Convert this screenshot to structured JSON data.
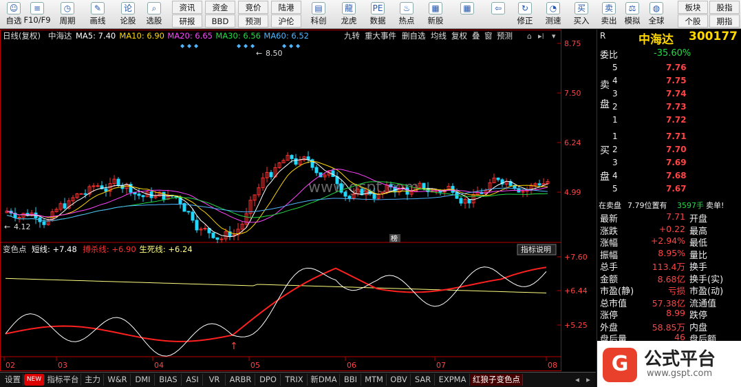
{
  "toolbar": {
    "buttons": [
      {
        "label": "自选",
        "icon": "user-icon"
      },
      {
        "label": "F10/F9",
        "icon": "document-icon"
      },
      {
        "label": "周期",
        "icon": "clock-icon"
      },
      {
        "label": "画线",
        "icon": "pen-icon"
      },
      {
        "label": "论股",
        "icon": "chat-icon"
      },
      {
        "label": "选股",
        "icon": "filter-icon"
      }
    ],
    "small_buttons": [
      "资讯",
      "资金",
      "竞价",
      "陆港",
      "研报",
      "BBD",
      "预测",
      "沪伦"
    ],
    "right_buttons": [
      {
        "label": "科创",
        "icon": "chart-icon"
      },
      {
        "label": "龙虎",
        "icon": "dragon-icon"
      },
      {
        "label": "数据",
        "icon": "pe-icon"
      },
      {
        "label": "热点",
        "icon": "hot-icon"
      },
      {
        "label": "新股",
        "icon": "ipo-icon"
      },
      {
        "label": "",
        "icon": "grid-icon"
      },
      {
        "label": "",
        "icon": "back-icon"
      },
      {
        "label": "修正",
        "icon": "refresh-icon"
      },
      {
        "label": "测速",
        "icon": "speed-icon"
      },
      {
        "label": "买入",
        "icon": "buy-icon"
      },
      {
        "label": "卖出",
        "icon": "sell-icon"
      },
      {
        "label": "模拟",
        "icon": "gavel-icon"
      },
      {
        "label": "全球",
        "icon": "globe-icon"
      }
    ],
    "far_right": [
      "板块",
      "股指",
      "个股",
      "期指"
    ]
  },
  "kchart": {
    "period": "日线(复权)",
    "name": "中海达",
    "ma": [
      {
        "label": "MA5: 7.40",
        "color": "#ffffff"
      },
      {
        "label": "MA10: 6.90",
        "color": "#ffd800"
      },
      {
        "label": "MA20: 6.65",
        "color": "#ff44ff"
      },
      {
        "label": "MA30: 6.56",
        "color": "#22dd44"
      },
      {
        "label": "MA60: 6.52",
        "color": "#4fb5ff"
      }
    ],
    "menu": [
      "九转",
      "重大事件",
      "删自选",
      "均线",
      "复权",
      "叠",
      "窗",
      "预测"
    ],
    "y_ticks": [
      "8.75",
      "7.50",
      "6.24",
      "4.99"
    ],
    "high_label": "8.50",
    "low_label": "4.12",
    "watermark": "www.gspt.com",
    "overlay_tag": "榜"
  },
  "indicator": {
    "title": "变色点",
    "lines": [
      {
        "label": "短线: +7.48",
        "color": "#ffffff"
      },
      {
        "label": "搏杀线: +6.90",
        "color": "#ff3030"
      },
      {
        "label": "生死线: +6.24",
        "color": "#ffff80"
      }
    ],
    "help_button": "指标说明",
    "y_ticks": [
      "+7.60",
      "+6.44",
      "+5.25"
    ]
  },
  "x_labels": [
    "02",
    "03",
    "04",
    "05",
    "06",
    "07",
    "08"
  ],
  "quote": {
    "code_prefix": "R",
    "name": "中海达",
    "code": "300177",
    "wei_bi_label": "委比",
    "wei_bi": "-35.60%",
    "sell_label": "卖盘",
    "buy_label": "买盘",
    "sells": [
      {
        "n": "5",
        "p": "7.76"
      },
      {
        "n": "4",
        "p": "7.75"
      },
      {
        "n": "3",
        "p": "7.74"
      },
      {
        "n": "2",
        "p": "7.73"
      },
      {
        "n": "1",
        "p": "7.72"
      }
    ],
    "buys": [
      {
        "n": "1",
        "p": "7.71"
      },
      {
        "n": "2",
        "p": "7.70"
      },
      {
        "n": "3",
        "p": "7.69"
      },
      {
        "n": "4",
        "p": "7.68"
      },
      {
        "n": "5",
        "p": "7.67"
      }
    ],
    "notice_a": "在卖盘",
    "notice_b": "7.79位置有",
    "notice_c": "3597手",
    "notice_d": "卖单!",
    "stats": [
      {
        "k": "最新",
        "v": "7.71",
        "k2": "开盘"
      },
      {
        "k": "涨跌",
        "v": "+0.22",
        "k2": "最高"
      },
      {
        "k": "涨幅",
        "v": "+2.94%",
        "k2": "最低"
      },
      {
        "k": "振幅",
        "v": "8.95%",
        "k2": "量比"
      },
      {
        "k": "总手",
        "v": "113.4万",
        "k2": "换手"
      },
      {
        "k": "金额",
        "v": "8.68亿",
        "k2": "换手(实)"
      },
      {
        "k": "市盈(静)",
        "v": "亏损",
        "k2": "市盈(动)"
      },
      {
        "k": "总市值",
        "v": "57.38亿",
        "k2": "流通值"
      },
      {
        "k": "涨停",
        "v": "8.99",
        "k2": "跌停"
      },
      {
        "k": "外盘",
        "v": "58.85万",
        "k2": "内盘"
      },
      {
        "k": "盘后量",
        "v": "46",
        "k2": "盘后额"
      }
    ]
  },
  "tabs": [
    "设置",
    "NEW",
    "指标平台",
    "主力",
    "W&R",
    "DMI",
    "BIAS",
    "ASI",
    "VR",
    "ARBR",
    "DPO",
    "TRIX",
    "新DMA",
    "BBI",
    "MTM",
    "OBV",
    "SAR",
    "EXPMA",
    "红狼子变色点"
  ],
  "logo": {
    "title": "公式平台",
    "url": "www.gspt.com"
  },
  "colors": {
    "up": "#ff3030",
    "down": "#22d8ff",
    "bg": "#000000"
  }
}
